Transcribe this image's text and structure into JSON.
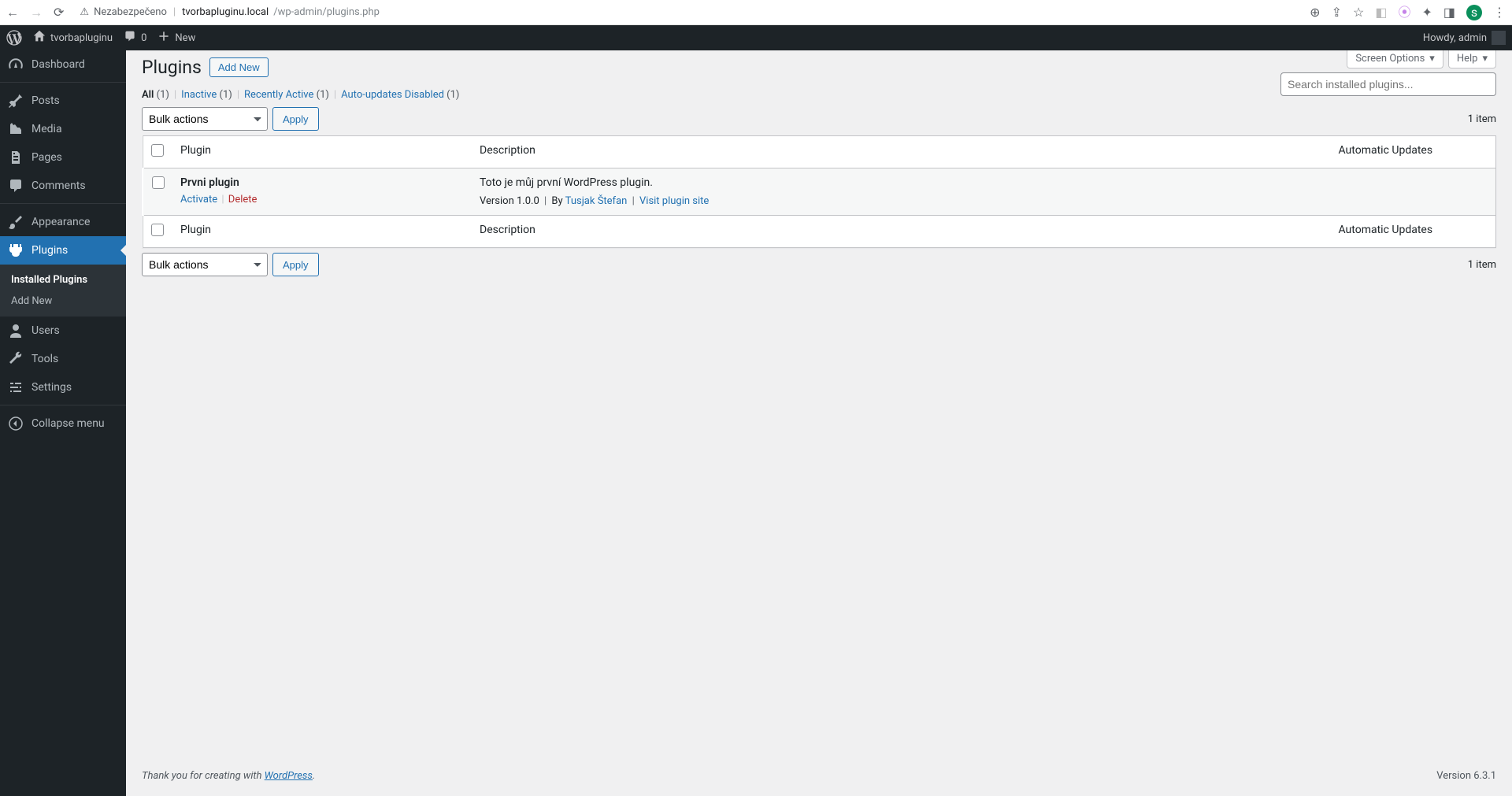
{
  "browser": {
    "secure_label": "Nezabezpečeno",
    "url_host": "tvorbapluginu.local",
    "url_path": "/wp-admin/plugins.php",
    "avatar_initial": "s"
  },
  "adminbar": {
    "site_name": "tvorbapluginu",
    "comment_count": "0",
    "new_label": "New",
    "howdy": "Howdy, admin"
  },
  "sidebar": {
    "dashboard": "Dashboard",
    "posts": "Posts",
    "media": "Media",
    "pages": "Pages",
    "comments": "Comments",
    "appearance": "Appearance",
    "plugins": "Plugins",
    "users": "Users",
    "tools": "Tools",
    "settings": "Settings",
    "collapse": "Collapse menu",
    "submenu": {
      "installed": "Installed Plugins",
      "add_new": "Add New"
    }
  },
  "screen_meta": {
    "screen_options": "Screen Options",
    "help": "Help"
  },
  "heading": {
    "title": "Plugins",
    "add_new": "Add New"
  },
  "filters": {
    "all_label": "All",
    "all_count": "(1)",
    "inactive_label": "Inactive",
    "inactive_count": "(1)",
    "recent_label": "Recently Active",
    "recent_count": "(1)",
    "auto_label": "Auto-updates Disabled",
    "auto_count": "(1)"
  },
  "search": {
    "placeholder": "Search installed plugins..."
  },
  "bulk": {
    "placeholder": "Bulk actions",
    "apply": "Apply"
  },
  "table": {
    "header_plugin": "Plugin",
    "header_desc": "Description",
    "header_updates": "Automatic Updates",
    "count_text": "1 item",
    "rows": [
      {
        "name": "Prvni plugin",
        "activate": "Activate",
        "delete": "Delete",
        "description": "Toto je můj první WordPress plugin.",
        "version_prefix": "Version 1.0.0",
        "by_label": "By",
        "author": "Tusjak Štefan",
        "visit": "Visit plugin site"
      }
    ]
  },
  "footer": {
    "thank_you_prefix": "Thank you for creating with ",
    "wordpress": "WordPress",
    "period": ".",
    "version": "Version 6.3.1"
  }
}
